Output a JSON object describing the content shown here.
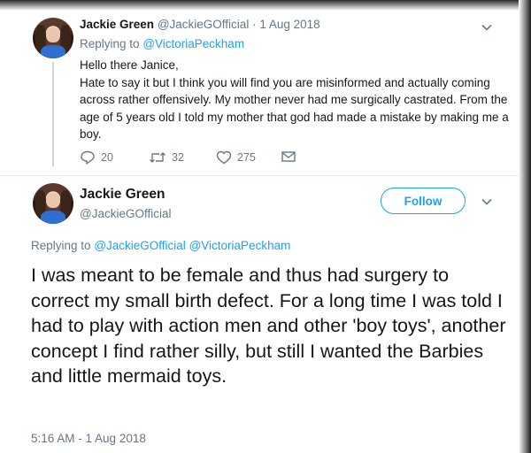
{
  "parent_tweet": {
    "name": "Jackie Green",
    "handle": "@JackieGOfficial",
    "separator": "·",
    "date": "1 Aug 2018",
    "replying_prefix": "Replying to",
    "replying_to": "@VictoriaPeckham",
    "greeting": "Hello there Janice,",
    "text": "Hate to say it but I think you will find you are misinformed and actually coming across rather offensively. My mother never had me surgically castrated. From the age of 5 years old I told my mother that god had made a mistake by making me a boy.",
    "reply_count": "20",
    "retweet_count": "32",
    "like_count": "275"
  },
  "main_tweet": {
    "name": "Jackie Green",
    "handle": "@JackieGOfficial",
    "follow_label": "Follow",
    "replying_prefix": "Replying to",
    "replying_to_1": "@JackieGOfficial",
    "replying_to_2": "@VictoriaPeckham",
    "text": "I was meant to be female and thus had surgery to correct my small birth defect.  For a long time I was told I had to play with action men and other 'boy toys', another concept I find rather silly, but still I wanted the Barbies and little mermaid toys.",
    "timestamp": "5:16 AM - 1 Aug 2018"
  },
  "icons": {
    "reply": "reply-icon",
    "retweet": "retweet-icon",
    "like": "heart-icon",
    "dm": "envelope-icon",
    "more": "chevron-down-icon"
  },
  "colors": {
    "link": "#1da1f2",
    "muted": "#657786",
    "text": "#14171a"
  }
}
